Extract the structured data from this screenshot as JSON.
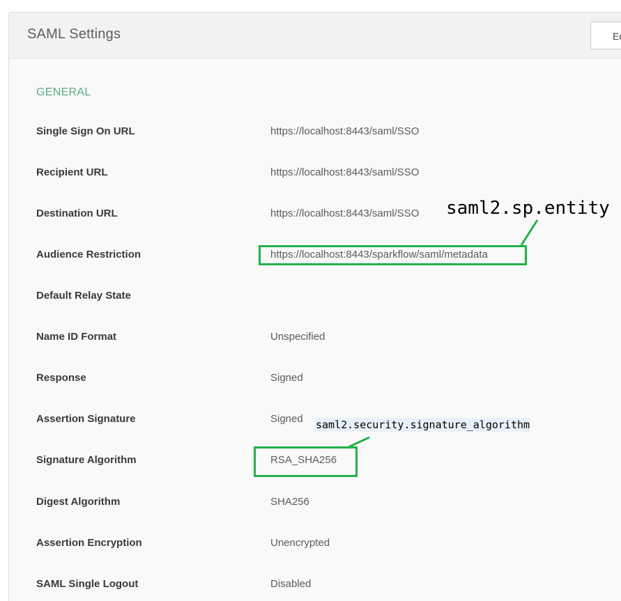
{
  "panel": {
    "title": "SAML Settings",
    "edit_label": "Edit"
  },
  "section": {
    "title": "GENERAL"
  },
  "rows": [
    {
      "label": "Single Sign On URL",
      "value": "https://localhost:8443/saml/SSO"
    },
    {
      "label": "Recipient URL",
      "value": "https://localhost:8443/saml/SSO"
    },
    {
      "label": "Destination URL",
      "value": "https://localhost:8443/saml/SSO"
    },
    {
      "label": "Audience Restriction",
      "value": "https://localhost:8443/sparkflow/saml/metadata"
    },
    {
      "label": "Default Relay State",
      "value": ""
    },
    {
      "label": "Name ID Format",
      "value": "Unspecified"
    },
    {
      "label": "Response",
      "value": "Signed"
    },
    {
      "label": "Assertion Signature",
      "value": "Signed"
    },
    {
      "label": "Signature Algorithm",
      "value": "RSA_SHA256"
    },
    {
      "label": "Digest Algorithm",
      "value": "SHA256"
    },
    {
      "label": "Assertion Encryption",
      "value": "Unencrypted"
    },
    {
      "label": "SAML Single Logout",
      "value": "Disabled"
    }
  ],
  "annotations": {
    "entity_id_label": "saml2.sp.entity",
    "signature_algorithm_label": "saml2.security.signature_algorithm",
    "highlight_color": "#22b14c"
  }
}
